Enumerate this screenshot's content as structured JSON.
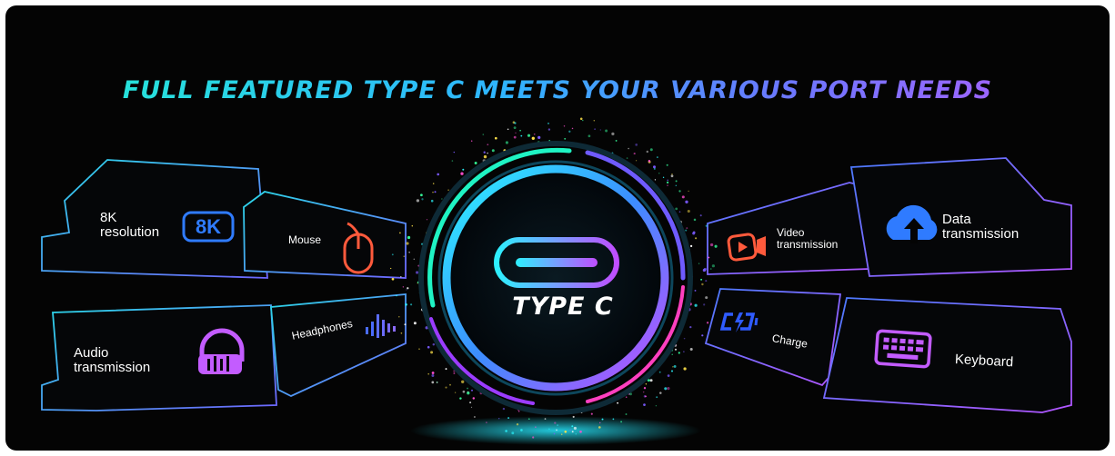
{
  "banner": {
    "title": "FULL FEATURED TYPE C MEETS YOUR VARIOUS PORT NEEDS",
    "center_label": "TYPE C"
  },
  "features_left": [
    {
      "label_line1": "8K",
      "label_line2": "resolution",
      "badge": "8K",
      "icon": "8k-badge-icon"
    },
    {
      "label_line1": "Mouse",
      "icon": "mouse-icon"
    },
    {
      "label_line1": "Audio",
      "label_line2": "transmission",
      "icon": "headphones-icon"
    },
    {
      "label_line1": "Headphones",
      "icon": "sound-wave-icon"
    }
  ],
  "features_right": [
    {
      "label_line1": "Video",
      "label_line2": "transmission",
      "icon": "video-camera-icon"
    },
    {
      "label_line1": "Data",
      "label_line2": "transmission",
      "icon": "cloud-upload-icon"
    },
    {
      "label_line1": "Charge",
      "icon": "charging-plug-icon"
    },
    {
      "label_line1": "Keyboard",
      "icon": "keyboard-icon"
    }
  ],
  "colors": {
    "background": "#040404",
    "cyan": "#24e6ff",
    "purple": "#a44cff",
    "blue": "#2d6bff",
    "icon_orange": "#ff5a3c",
    "icon_purple": "#c35cff",
    "icon_blue": "#2f7bff"
  }
}
